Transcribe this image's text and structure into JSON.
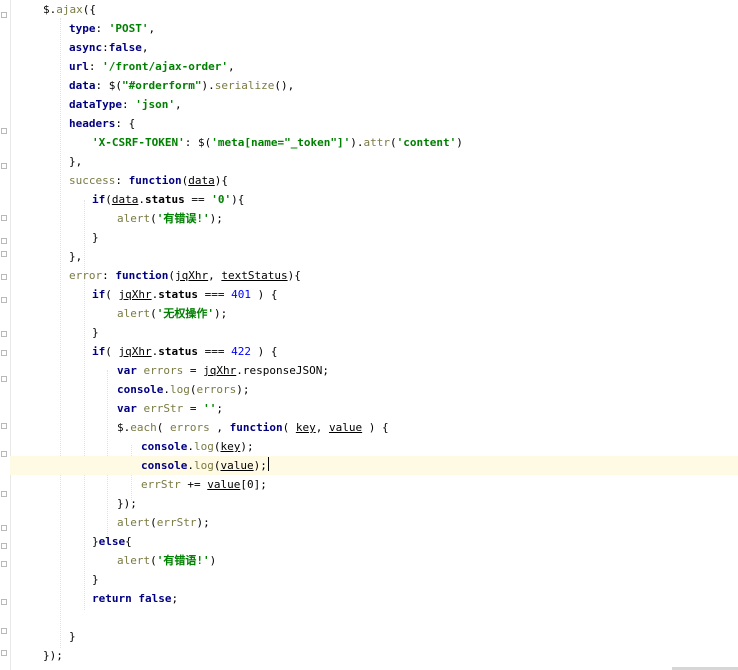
{
  "editor": {
    "current_line_index": 24,
    "lines": [
      {
        "segments": [
          {
            "t": "$",
            "c": "plain"
          },
          {
            "t": ".",
            "c": "plain"
          },
          {
            "t": "ajax",
            "c": "fn"
          },
          {
            "t": "({",
            "c": "plain"
          }
        ]
      },
      {
        "segments": [
          {
            "t": "type",
            "c": "kw"
          },
          {
            "t": ": ",
            "c": "plain"
          },
          {
            "t": "'POST'",
            "c": "str"
          },
          {
            "t": ",",
            "c": "plain"
          }
        ]
      },
      {
        "segments": [
          {
            "t": "async",
            "c": "kw"
          },
          {
            "t": ":",
            "c": "plain"
          },
          {
            "t": "false",
            "c": "kw"
          },
          {
            "t": ",",
            "c": "plain"
          }
        ]
      },
      {
        "segments": [
          {
            "t": "url",
            "c": "kw"
          },
          {
            "t": ": ",
            "c": "plain"
          },
          {
            "t": "'/front/ajax-order'",
            "c": "str"
          },
          {
            "t": ",",
            "c": "plain"
          }
        ]
      },
      {
        "segments": [
          {
            "t": "data",
            "c": "kw"
          },
          {
            "t": ": ",
            "c": "plain"
          },
          {
            "t": "$(",
            "c": "plain"
          },
          {
            "t": "\"#orderform\"",
            "c": "str"
          },
          {
            "t": ").",
            "c": "plain"
          },
          {
            "t": "serialize",
            "c": "fn"
          },
          {
            "t": "(),",
            "c": "plain"
          }
        ]
      },
      {
        "segments": [
          {
            "t": "dataType",
            "c": "kw"
          },
          {
            "t": ": ",
            "c": "plain"
          },
          {
            "t": "'json'",
            "c": "str"
          },
          {
            "t": ",",
            "c": "plain"
          }
        ]
      },
      {
        "segments": [
          {
            "t": "headers",
            "c": "kw"
          },
          {
            "t": ": {",
            "c": "plain"
          }
        ]
      },
      {
        "segments": [
          {
            "t": "'X-CSRF-TOKEN'",
            "c": "str"
          },
          {
            "t": ": $(",
            "c": "plain"
          },
          {
            "t": "'meta[name=\"_token\"]'",
            "c": "str"
          },
          {
            "t": ").",
            "c": "plain"
          },
          {
            "t": "attr",
            "c": "fn"
          },
          {
            "t": "(",
            "c": "plain"
          },
          {
            "t": "'content'",
            "c": "str"
          },
          {
            "t": ")",
            "c": "plain"
          }
        ]
      },
      {
        "segments": [
          {
            "t": "},",
            "c": "plain"
          }
        ]
      },
      {
        "segments": [
          {
            "t": "success",
            "c": "fn"
          },
          {
            "t": ": ",
            "c": "plain"
          },
          {
            "t": "function",
            "c": "kw"
          },
          {
            "t": "(",
            "c": "plain"
          },
          {
            "t": "data",
            "c": "und"
          },
          {
            "t": "){",
            "c": "plain"
          }
        ]
      },
      {
        "segments": [
          {
            "t": "if",
            "c": "kw"
          },
          {
            "t": "(",
            "c": "plain"
          },
          {
            "t": "data",
            "c": "und"
          },
          {
            "t": ".",
            "c": "plain"
          },
          {
            "t": "status",
            "c": "bold"
          },
          {
            "t": " == ",
            "c": "plain"
          },
          {
            "t": "'0'",
            "c": "str"
          },
          {
            "t": "){",
            "c": "plain"
          }
        ]
      },
      {
        "segments": [
          {
            "t": "alert",
            "c": "fn"
          },
          {
            "t": "(",
            "c": "plain"
          },
          {
            "t": "'有错误!'",
            "c": "str"
          },
          {
            "t": ");",
            "c": "plain"
          }
        ]
      },
      {
        "segments": [
          {
            "t": "}",
            "c": "plain"
          }
        ]
      },
      {
        "segments": [
          {
            "t": "},",
            "c": "plain"
          }
        ]
      },
      {
        "segments": [
          {
            "t": "error",
            "c": "fn"
          },
          {
            "t": ": ",
            "c": "plain"
          },
          {
            "t": "function",
            "c": "kw"
          },
          {
            "t": "(",
            "c": "plain"
          },
          {
            "t": "jqXhr",
            "c": "und"
          },
          {
            "t": ", ",
            "c": "plain"
          },
          {
            "t": "textStatus",
            "c": "und"
          },
          {
            "t": "){",
            "c": "plain"
          }
        ]
      },
      {
        "segments": [
          {
            "t": "if",
            "c": "kw"
          },
          {
            "t": "( ",
            "c": "plain"
          },
          {
            "t": "jqXhr",
            "c": "und"
          },
          {
            "t": ".",
            "c": "plain"
          },
          {
            "t": "status",
            "c": "bold"
          },
          {
            "t": " === ",
            "c": "plain"
          },
          {
            "t": "401",
            "c": "num"
          },
          {
            "t": " ) {",
            "c": "plain"
          }
        ]
      },
      {
        "segments": [
          {
            "t": "alert",
            "c": "fn"
          },
          {
            "t": "(",
            "c": "plain"
          },
          {
            "t": "'无权操作'",
            "c": "str"
          },
          {
            "t": ");",
            "c": "plain"
          }
        ]
      },
      {
        "segments": [
          {
            "t": "}",
            "c": "plain"
          }
        ]
      },
      {
        "segments": [
          {
            "t": "if",
            "c": "kw"
          },
          {
            "t": "( ",
            "c": "plain"
          },
          {
            "t": "jqXhr",
            "c": "und"
          },
          {
            "t": ".",
            "c": "plain"
          },
          {
            "t": "status",
            "c": "bold"
          },
          {
            "t": " === ",
            "c": "plain"
          },
          {
            "t": "422",
            "c": "num"
          },
          {
            "t": " ) {",
            "c": "plain"
          }
        ]
      },
      {
        "segments": [
          {
            "t": "var",
            "c": "kw"
          },
          {
            "t": " ",
            "c": "plain"
          },
          {
            "t": "errors",
            "c": "fn"
          },
          {
            "t": " = ",
            "c": "plain"
          },
          {
            "t": "jqXhr",
            "c": "und"
          },
          {
            "t": ".responseJSON;",
            "c": "plain"
          }
        ]
      },
      {
        "segments": [
          {
            "t": "console",
            "c": "kw"
          },
          {
            "t": ".",
            "c": "plain"
          },
          {
            "t": "log",
            "c": "fn"
          },
          {
            "t": "(",
            "c": "plain"
          },
          {
            "t": "errors",
            "c": "fn"
          },
          {
            "t": ");",
            "c": "plain"
          }
        ]
      },
      {
        "segments": [
          {
            "t": "var",
            "c": "kw"
          },
          {
            "t": " ",
            "c": "plain"
          },
          {
            "t": "errStr",
            "c": "fn"
          },
          {
            "t": " = ",
            "c": "plain"
          },
          {
            "t": "''",
            "c": "str"
          },
          {
            "t": ";",
            "c": "plain"
          }
        ]
      },
      {
        "segments": [
          {
            "t": "$",
            "c": "plain"
          },
          {
            "t": ".",
            "c": "plain"
          },
          {
            "t": "each",
            "c": "fn"
          },
          {
            "t": "( ",
            "c": "plain"
          },
          {
            "t": "errors",
            "c": "fn"
          },
          {
            "t": " , ",
            "c": "plain"
          },
          {
            "t": "function",
            "c": "kw"
          },
          {
            "t": "( ",
            "c": "plain"
          },
          {
            "t": "key",
            "c": "und"
          },
          {
            "t": ", ",
            "c": "plain"
          },
          {
            "t": "value",
            "c": "und"
          },
          {
            "t": " ) {",
            "c": "plain"
          }
        ]
      },
      {
        "segments": [
          {
            "t": "console",
            "c": "kw"
          },
          {
            "t": ".",
            "c": "plain"
          },
          {
            "t": "log",
            "c": "fn"
          },
          {
            "t": "(",
            "c": "plain"
          },
          {
            "t": "key",
            "c": "und"
          },
          {
            "t": ");",
            "c": "plain"
          }
        ]
      },
      {
        "segments": [
          {
            "t": "console",
            "c": "kw"
          },
          {
            "t": ".",
            "c": "plain"
          },
          {
            "t": "log",
            "c": "fn"
          },
          {
            "t": "(",
            "c": "plain"
          },
          {
            "t": "value",
            "c": "und"
          },
          {
            "t": ");",
            "c": "plain"
          }
        ]
      },
      {
        "segments": [
          {
            "t": "errStr",
            "c": "fn"
          },
          {
            "t": " += ",
            "c": "plain"
          },
          {
            "t": "value",
            "c": "und"
          },
          {
            "t": "[0];",
            "c": "plain"
          }
        ]
      },
      {
        "segments": [
          {
            "t": "});",
            "c": "plain"
          }
        ]
      },
      {
        "segments": [
          {
            "t": "alert",
            "c": "fn"
          },
          {
            "t": "(",
            "c": "plain"
          },
          {
            "t": "errStr",
            "c": "fn"
          },
          {
            "t": ");",
            "c": "plain"
          }
        ]
      },
      {
        "segments": [
          {
            "t": "}",
            "c": "plain"
          },
          {
            "t": "else",
            "c": "kw"
          },
          {
            "t": "{",
            "c": "plain"
          }
        ]
      },
      {
        "segments": [
          {
            "t": "alert",
            "c": "fn"
          },
          {
            "t": "(",
            "c": "plain"
          },
          {
            "t": "'有错语!'",
            "c": "str"
          },
          {
            "t": ")",
            "c": "plain"
          }
        ]
      },
      {
        "segments": [
          {
            "t": "}",
            "c": "plain"
          }
        ]
      },
      {
        "segments": [
          {
            "t": "return",
            "c": "kw"
          },
          {
            "t": " ",
            "c": "plain"
          },
          {
            "t": "false",
            "c": "kw"
          },
          {
            "t": ";",
            "c": "plain"
          }
        ]
      },
      {
        "segments": []
      },
      {
        "segments": [
          {
            "t": "}",
            "c": "plain"
          }
        ]
      },
      {
        "segments": [
          {
            "t": "});",
            "c": "plain"
          }
        ]
      }
    ]
  },
  "colors": {
    "keyword": "#000080",
    "string": "#008000",
    "number": "#0000ff",
    "function": "#7a7a43",
    "current_line": "#fffae3"
  }
}
